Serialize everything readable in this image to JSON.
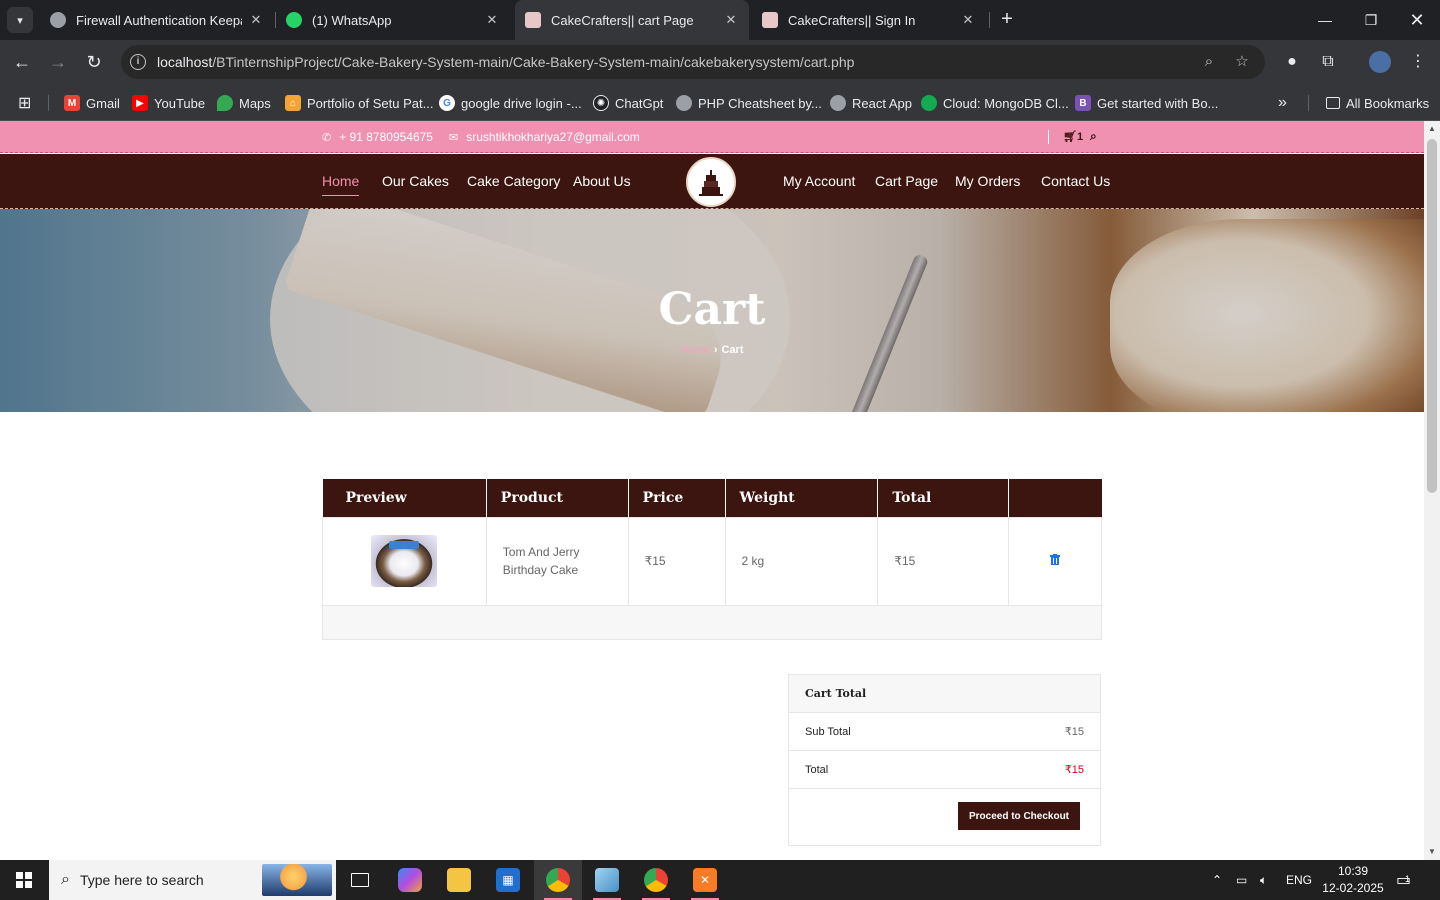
{
  "browser": {
    "tabs": [
      {
        "label": "Firewall Authentication Keepalive",
        "active": false,
        "favicon_color": "#9aa0a6"
      },
      {
        "label": "(1) WhatsApp",
        "active": false,
        "favicon_color": "#25d366"
      },
      {
        "label": "CakeCrafters|| cart Page",
        "active": true,
        "favicon_color": "#e8c7c7"
      },
      {
        "label": "CakeCrafters|| Sign In",
        "active": false,
        "favicon_color": "#e8c7c7"
      }
    ],
    "address": {
      "host": "localhost",
      "path": "/BTinternshipProject/Cake-Bakery-System-main/Cake-Bakery-System-main/cakebakerysystem/cart.php"
    },
    "bookmarks": [
      {
        "label": "Gmail",
        "icon": "gmail-icon",
        "color": "#ea4335"
      },
      {
        "label": "YouTube",
        "icon": "youtube-icon",
        "color": "#ff0000"
      },
      {
        "label": "Maps",
        "icon": "maps-icon",
        "color": "#34a853"
      },
      {
        "label": "Portfolio of Setu Pat...",
        "icon": "portfolio-icon",
        "color": "#f4a335"
      },
      {
        "label": "google drive login -...",
        "icon": "google-icon",
        "color": "#4285f4"
      },
      {
        "label": "ChatGpt",
        "icon": "chatgpt-icon",
        "color": "#202124"
      },
      {
        "label": "PHP Cheatsheet by...",
        "icon": "globe-icon",
        "color": "#9aa0a6"
      },
      {
        "label": "React App",
        "icon": "globe-icon",
        "color": "#9aa0a6"
      },
      {
        "label": "Cloud: MongoDB Cl...",
        "icon": "mongodb-icon",
        "color": "#13aa52"
      },
      {
        "label": "Get started with Bo...",
        "icon": "bootstrap-icon",
        "color": "#7952b3"
      }
    ],
    "all_bookmarks": "All Bookmarks"
  },
  "site": {
    "topbar": {
      "phone": "+ 91 8780954675",
      "email": "srushtikhokhariya27@gmail.com",
      "cart_count": "1"
    },
    "nav_left": [
      "Home",
      "Our Cakes",
      "Cake Category",
      "About Us"
    ],
    "nav_right": [
      "My Account",
      "Cart Page",
      "My Orders",
      "Contact Us"
    ],
    "hero": {
      "title": "Cart",
      "crumb_home": "Home",
      "crumb_current": "Cart"
    },
    "cart_table": {
      "headers": [
        "Preview",
        "Product",
        "Price",
        "Weight",
        "Total",
        ""
      ],
      "rows": [
        {
          "product": "Tom And Jerry Birthday Cake",
          "price": "₹15",
          "weight": "2 kg",
          "total": "₹15"
        }
      ]
    },
    "cart_total": {
      "title": "Cart Total",
      "subtotal_label": "Sub Total",
      "subtotal_value": "₹15",
      "total_label": "Total",
      "total_value": "₹15",
      "checkout_label": "Proceed to Checkout"
    }
  },
  "taskbar": {
    "search_placeholder": "Type here to search",
    "language": "ENG",
    "time": "10:39",
    "date": "12-02-2025",
    "notifications": "1"
  },
  "colors": {
    "brand_dark": "#3d1510",
    "brand_pink": "#f191b1",
    "accent_pink": "#f28fb0",
    "delete_blue": "#1a73e8",
    "total_red": "#d0021b"
  }
}
